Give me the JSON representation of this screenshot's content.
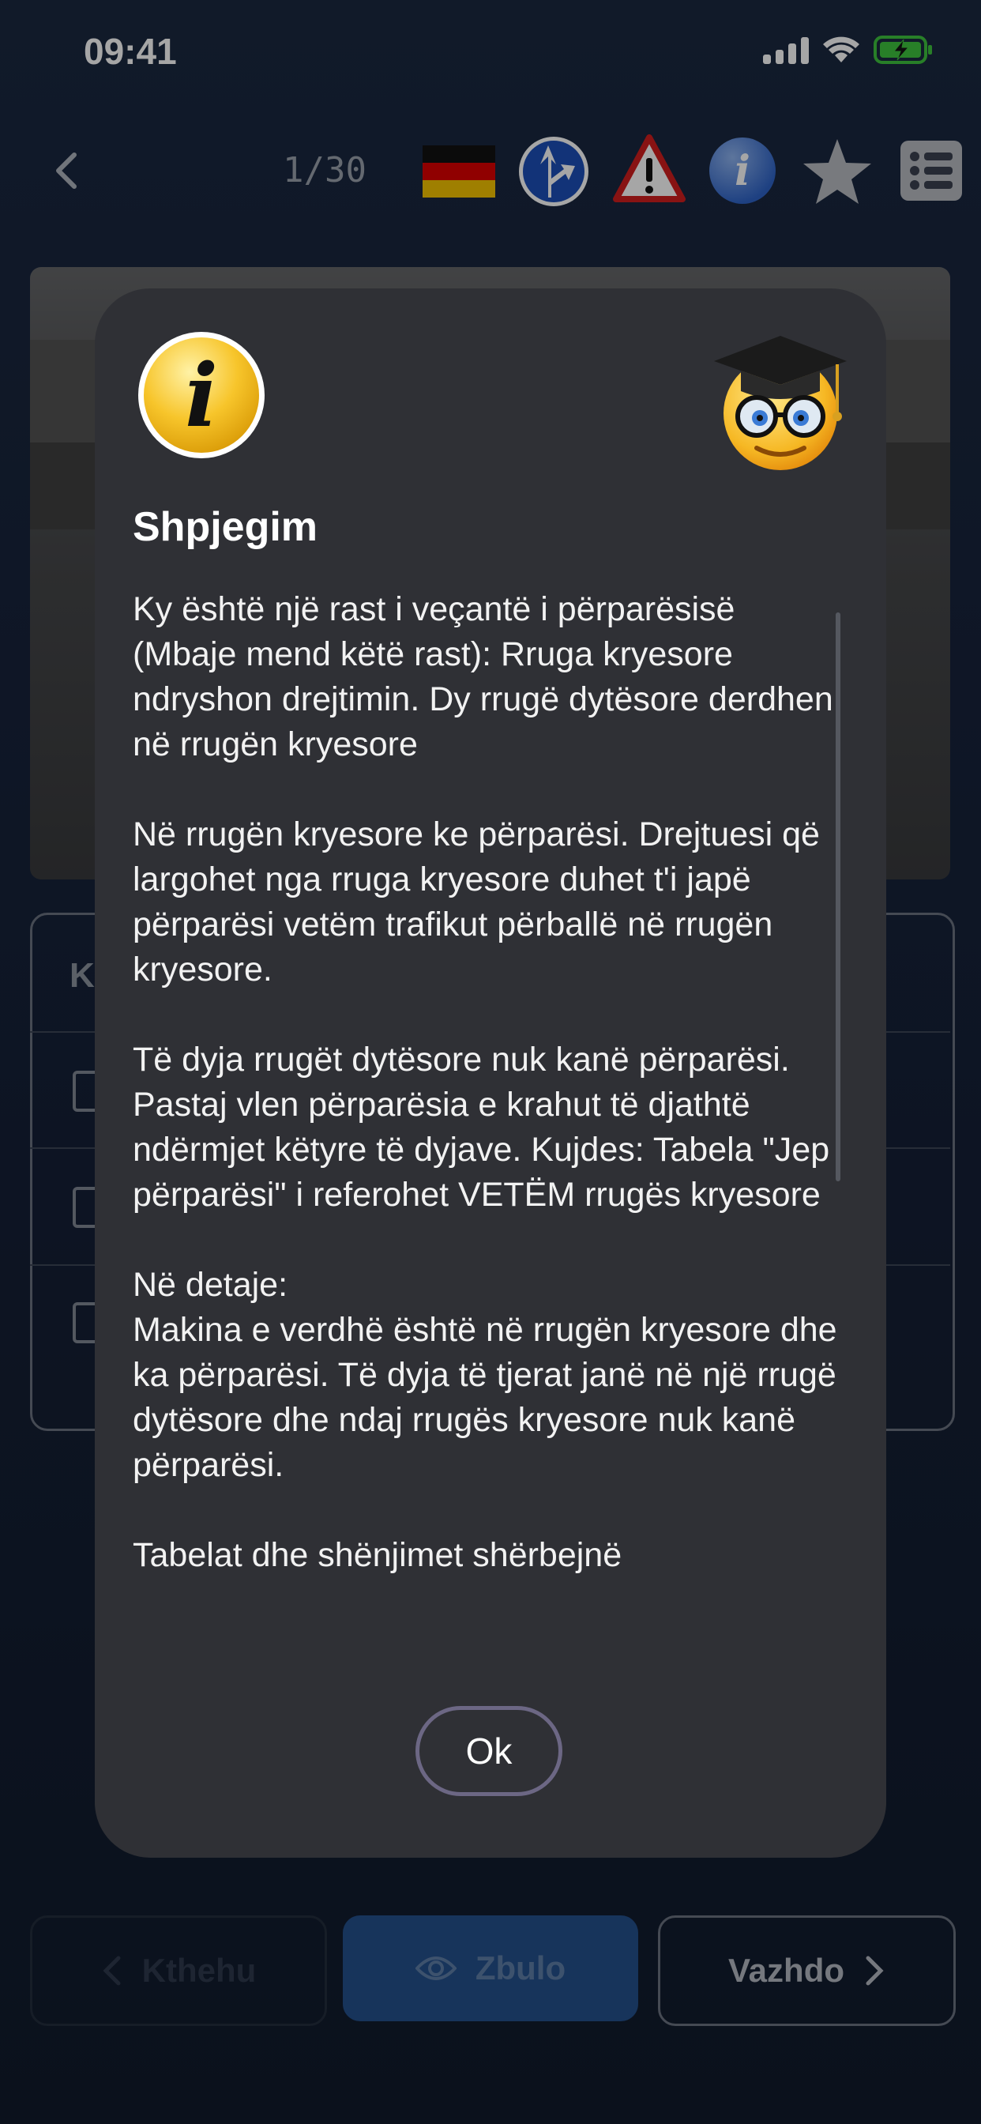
{
  "status_bar": {
    "time": "09:41"
  },
  "top_nav": {
    "counter": "1/30",
    "icons": [
      "back-chevron-icon",
      "german-flag-icon",
      "priority-road-sign-icon",
      "warning-sign-icon",
      "info-icon",
      "star-icon",
      "list-icon"
    ]
  },
  "background": {
    "answers_header_partial": "K"
  },
  "modal": {
    "title": "Shpjegim",
    "paragraphs": [
      "Ky është një rast i veçantë i përparësisë (Mbaje mend këtë rast): Rruga kryesore ndryshon drejtimin. Dy rrugë dytësore derdhen në rrugën kryesore",
      "Në rrugën kryesore ke përparësi. Drejtuesi që largohet nga rruga kryesore duhet t'i japë përparësi vetëm trafikut përballë në rrugën kryesore.",
      "Të dyja rrugët dytësore nuk kanë përparësi. Pastaj vlen përparësia e krahut të djathtë ndërmjet këtyre të dyjave. Kujdes: Tabela \"Jep përparësi\" i referohet VETËM rrugës kryesore",
      "Në detaje:\nMakina e verdhë është në rrugën kryesore dhe ka përparësi. Të dyja të tjerat janë në një rrugë dytësore dhe ndaj rrugës kryesore nuk kanë përparësi.",
      "Tabelat dhe shënjimet shërbejnë"
    ],
    "ok_label": "Ok"
  },
  "bottom_bar": {
    "back_label": "Kthehu",
    "reveal_label": "Zbulo",
    "next_label": "Vazhdo"
  },
  "colors": {
    "modal_bg": "#2f3035",
    "page_bg": "#121c2b",
    "reveal_button": "#24508c",
    "ok_border": "#6c6784"
  }
}
